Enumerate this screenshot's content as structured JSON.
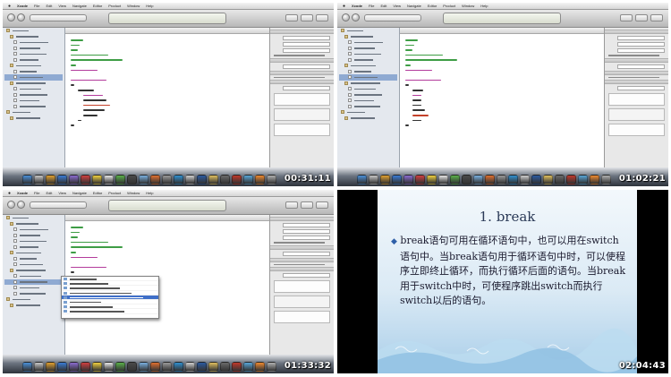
{
  "menubar": {
    "items": [
      "Xcode",
      "File",
      "Edit",
      "View",
      "Navigate",
      "Editor",
      "Product",
      "Window",
      "Help"
    ]
  },
  "panels": [
    {
      "timestamp": "00:31:11"
    },
    {
      "timestamp": "01:02:21"
    },
    {
      "timestamp": "01:33:32"
    },
    {
      "timestamp": "02:04:43"
    }
  ],
  "slide": {
    "title": "1. break",
    "bullet": "break语句可用在循环语句中，也可以用在switch语句中。当break语句用于循环语句中时，可以使程序立即终止循环，而执行循环后面的语句。当break用于switch中时，可使程序跳出switch而执行switch以后的语句。"
  },
  "colors": {
    "code_comment": "#3e9d45",
    "code_keyword": "#b33c9c",
    "code_string": "#c4412a",
    "selection": "#3f6fc8",
    "slide_title": "#2b3a57",
    "timestamp": "#ffffff"
  }
}
